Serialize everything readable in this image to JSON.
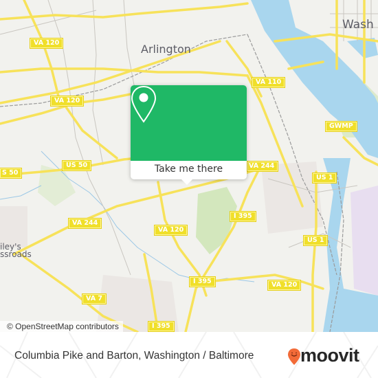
{
  "map": {
    "attribution": "© OpenStreetMap contributors",
    "colors": {
      "land": "#f2f2ee",
      "water": "#a9d6ee",
      "park": "#d3e7bd",
      "road": "#f7e25a",
      "accent": "#1fb866",
      "brand": "#f26b38"
    },
    "place_labels": {
      "arlington": "Arlington",
      "washington": "Wash",
      "baileys_1": "iley's",
      "baileys_2": "ssroads"
    },
    "road_shields": [
      {
        "id": "va120-a",
        "label": "VA 120"
      },
      {
        "id": "va120-b",
        "label": "VA 120"
      },
      {
        "id": "va120-c",
        "label": "VA 120"
      },
      {
        "id": "va120-d",
        "label": "VA 120"
      },
      {
        "id": "va120-e",
        "label": "VA 120"
      },
      {
        "id": "va110",
        "label": "VA 110"
      },
      {
        "id": "gwmp",
        "label": "GWMP"
      },
      {
        "id": "us50-a",
        "label": "US 50"
      },
      {
        "id": "us50-b",
        "label": "S 50"
      },
      {
        "id": "va244-a",
        "label": "VA 244"
      },
      {
        "id": "va244-b",
        "label": "VA 244"
      },
      {
        "id": "us1-a",
        "label": "US 1"
      },
      {
        "id": "us1-b",
        "label": "US 1"
      },
      {
        "id": "i395-a",
        "label": "I 395"
      },
      {
        "id": "i395-b",
        "label": "I 395"
      },
      {
        "id": "i395-c",
        "label": "I 395"
      },
      {
        "id": "va7",
        "label": "VA 7"
      }
    ]
  },
  "popup": {
    "icon": "location-pin-icon",
    "button_label": "Take me there"
  },
  "footer": {
    "title": "Columbia Pike and Barton, Washington / Baltimore",
    "brand_icon": "moovit-pin-icon",
    "brand_name": "moovit"
  }
}
